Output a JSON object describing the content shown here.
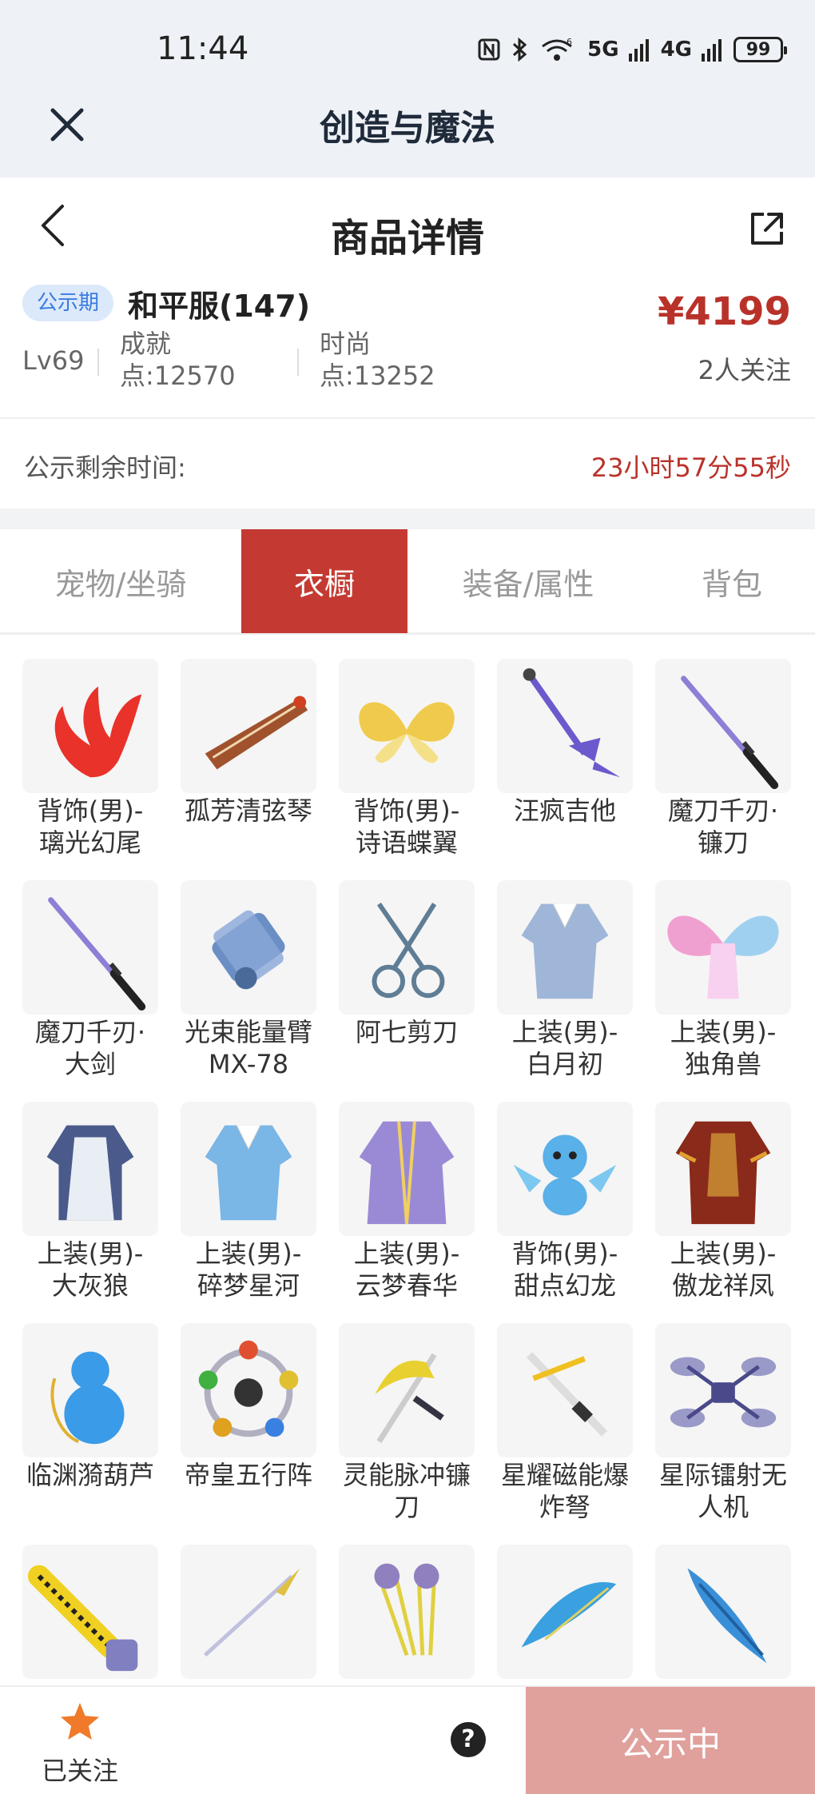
{
  "status_bar": {
    "time": "11:44",
    "icons": [
      "nfc-icon",
      "bluetooth-icon",
      "wifi-6-icon",
      "5g-signal-icon",
      "4g-signal-icon"
    ],
    "signal_5g": "5G",
    "signal_4g": "4G",
    "battery": "99"
  },
  "app_header": {
    "title": "创造与魔法"
  },
  "page_nav": {
    "title": "商品详情"
  },
  "product": {
    "tag": "公示期",
    "server": "和平服(147)",
    "price": "¥4199",
    "followers": "2人关注",
    "level": "Lv69",
    "achievement_label": "成就",
    "achievement_value": "点:12570",
    "fashion_label": "时尚",
    "fashion_value": "点:13252"
  },
  "countdown": {
    "label": "公示剩余时间:",
    "value": "23小时57分55秒"
  },
  "tabs": [
    {
      "label": "宠物/坐骑",
      "active": false
    },
    {
      "label": "衣橱",
      "active": true
    },
    {
      "label": "装备/属性",
      "active": false
    },
    {
      "label": "背包",
      "active": false
    }
  ],
  "items": [
    {
      "line1": "背饰(男)-",
      "line2": "璃光幻尾",
      "icon": "red-fox-tail",
      "color": "#e8322a"
    },
    {
      "line1": "孤芳清弦琴",
      "line2": "",
      "icon": "zither",
      "color": "#a0522d"
    },
    {
      "line1": "背饰(男)-",
      "line2": "诗语蝶翼",
      "icon": "butterfly-wings",
      "color": "#f0c53a"
    },
    {
      "line1": "汪疯吉他",
      "line2": "",
      "icon": "guitar",
      "color": "#6a5acd"
    },
    {
      "line1": "魔刀千刃·",
      "line2": "镰刀",
      "icon": "katana",
      "color": "#8b7fd6"
    },
    {
      "line1": "魔刀千刃·",
      "line2": "大剑",
      "icon": "katana",
      "color": "#8b7fd6"
    },
    {
      "line1": "光束能量臂",
      "line2": "MX-78",
      "icon": "energy-arm",
      "color": "#6b8fc4"
    },
    {
      "line1": "阿七剪刀",
      "line2": "",
      "icon": "scissors",
      "color": "#5f7d95"
    },
    {
      "line1": "上装(男)-",
      "line2": "白月初",
      "icon": "robe",
      "color": "#9fb6d8"
    },
    {
      "line1": "上装(男)-",
      "line2": "独角兽",
      "icon": "rainbow-wings",
      "color": "#e6a0d8"
    },
    {
      "line1": "上装(男)-",
      "line2": "大灰狼",
      "icon": "apron",
      "color": "#4a5a8a"
    },
    {
      "line1": "上装(男)-",
      "line2": "碎梦星河",
      "icon": "robe",
      "color": "#7ab6e6"
    },
    {
      "line1": "上装(男)-",
      "line2": "云梦春华",
      "icon": "royal-robe",
      "color": "#9a8ad6"
    },
    {
      "line1": "背饰(男)-",
      "line2": "甜点幻龙",
      "icon": "baby-dragon",
      "color": "#5ab0e8"
    },
    {
      "line1": "上装(男)-",
      "line2": "傲龙祥凤",
      "icon": "armor",
      "color": "#8a2a1a"
    },
    {
      "line1": "临渊漪葫芦",
      "line2": "",
      "icon": "gourd",
      "color": "#3a9be8"
    },
    {
      "line1": "帝皇五行阵",
      "line2": "",
      "icon": "five-element-ring",
      "color": "#d0a030"
    },
    {
      "line1": "灵能脉冲镰",
      "line2": "刀",
      "icon": "pulse-scythe",
      "color": "#e8d030"
    },
    {
      "line1": "星耀磁能爆",
      "line2": "炸弩",
      "icon": "crossbow",
      "color": "#f0c020"
    },
    {
      "line1": "星际镭射无",
      "line2": "人机",
      "icon": "drone",
      "color": "#4a4a8a"
    },
    {
      "line1": "",
      "line2": "",
      "icon": "chainsaw",
      "color": "#f0d020"
    },
    {
      "line1": "",
      "line2": "",
      "icon": "spear",
      "color": "#c0c0e0"
    },
    {
      "line1": "",
      "line2": "",
      "icon": "claws",
      "color": "#9080c0"
    },
    {
      "line1": "",
      "line2": "",
      "icon": "water-blade",
      "color": "#3aa0e0"
    },
    {
      "line1": "",
      "line2": "",
      "icon": "water-sword",
      "color": "#3a90d8"
    }
  ],
  "bottom_bar": {
    "follow_label": "已关注",
    "help": "?",
    "status_label": "公示中"
  }
}
